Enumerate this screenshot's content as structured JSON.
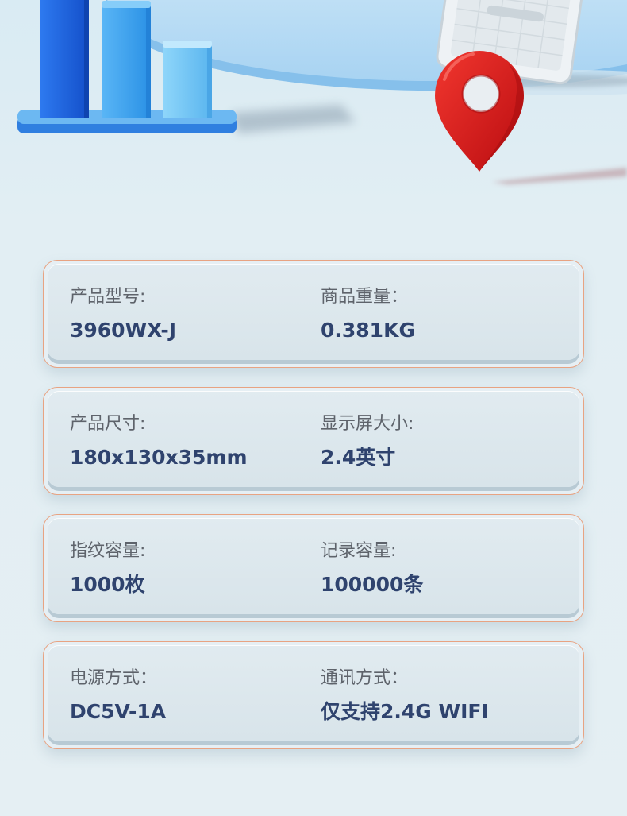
{
  "colors": {
    "label_text": "#5e636b",
    "value_text": "#2f436e",
    "card_border": "#e8a382",
    "pin_red": "#e0201c",
    "bar_blue": "#1f66e4"
  },
  "icons": [
    "bar-chart-icon",
    "location-pin-icon",
    "tablet-device-icon"
  ],
  "specs": [
    {
      "left": {
        "label": "产品型号:",
        "value": "3960WX-J"
      },
      "right": {
        "label": "商品重量：",
        "value": "0.381KG"
      }
    },
    {
      "left": {
        "label": "产品尺寸:",
        "value": "180x130x35mm"
      },
      "right": {
        "label": "显示屏大小:",
        "value": "2.4英寸"
      }
    },
    {
      "left": {
        "label": "指纹容量:",
        "value": "1000枚"
      },
      "right": {
        "label": "记录容量:",
        "value": "100000条"
      }
    },
    {
      "left": {
        "label": "电源方式：",
        "value": "DC5V-1A"
      },
      "right": {
        "label": "通讯方式：",
        "value": "仅支持2.4G WIFI"
      }
    }
  ]
}
